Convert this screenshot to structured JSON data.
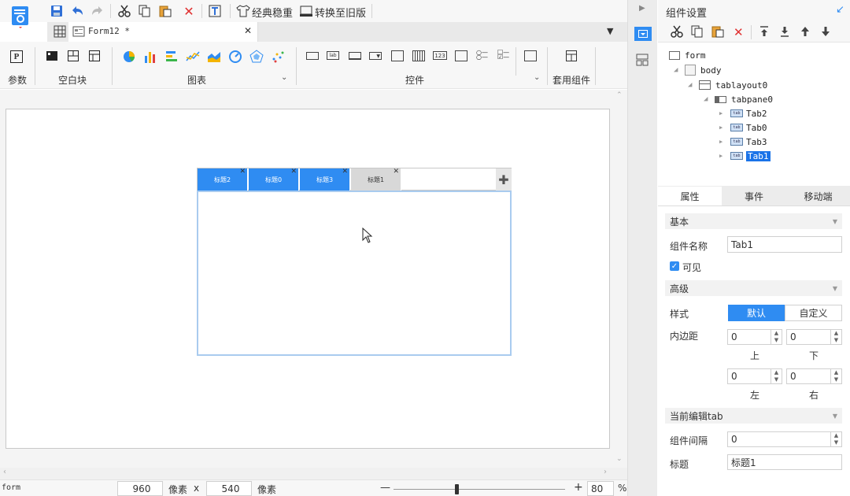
{
  "toolbar": {
    "classic_style": "经典稳重",
    "convert_old": "转换至旧版"
  },
  "tabs": {
    "file_tab": "Form12 *"
  },
  "ribbon": {
    "params": "参数",
    "blank": "空白块",
    "chart": "图表",
    "controls": "控件",
    "preset": "套用组件"
  },
  "canvas": {
    "tabs": [
      {
        "label": "标题2",
        "active": false
      },
      {
        "label": "标题0",
        "active": false
      },
      {
        "label": "标题3",
        "active": false
      },
      {
        "label": "标题1",
        "active": true
      }
    ]
  },
  "statusbar": {
    "form": "form",
    "width": "960",
    "width_unit": "像素",
    "x": "x",
    "height": "540",
    "height_unit": "像素",
    "zoom": "80",
    "percent": "%"
  },
  "panel": {
    "title": "组件设置",
    "tree": [
      "form",
      "body",
      "tablayout0",
      "tabpane0",
      "Tab2",
      "Tab0",
      "Tab3",
      "Tab1"
    ],
    "tabs": [
      "属性",
      "事件",
      "移动端"
    ],
    "basic": "基本",
    "name_label": "组件名称",
    "name_value": "Tab1",
    "visible_label": "可见",
    "advanced": "高级",
    "style_label": "样式",
    "style_default": "默认",
    "style_custom": "自定义",
    "padding_label": "内边距",
    "pad_top": "0",
    "pad_bottom": "0",
    "pad_left": "0",
    "pad_right": "0",
    "top": "上",
    "bottom": "下",
    "left": "左",
    "right": "右",
    "current_tab": "当前编辑tab",
    "spacing_label": "组件间隔",
    "spacing_value": "0",
    "caption_label": "标题",
    "caption_value": "标题1"
  },
  "colors": {
    "accent": "#2f8cf2",
    "selected": "#1a73e8"
  }
}
